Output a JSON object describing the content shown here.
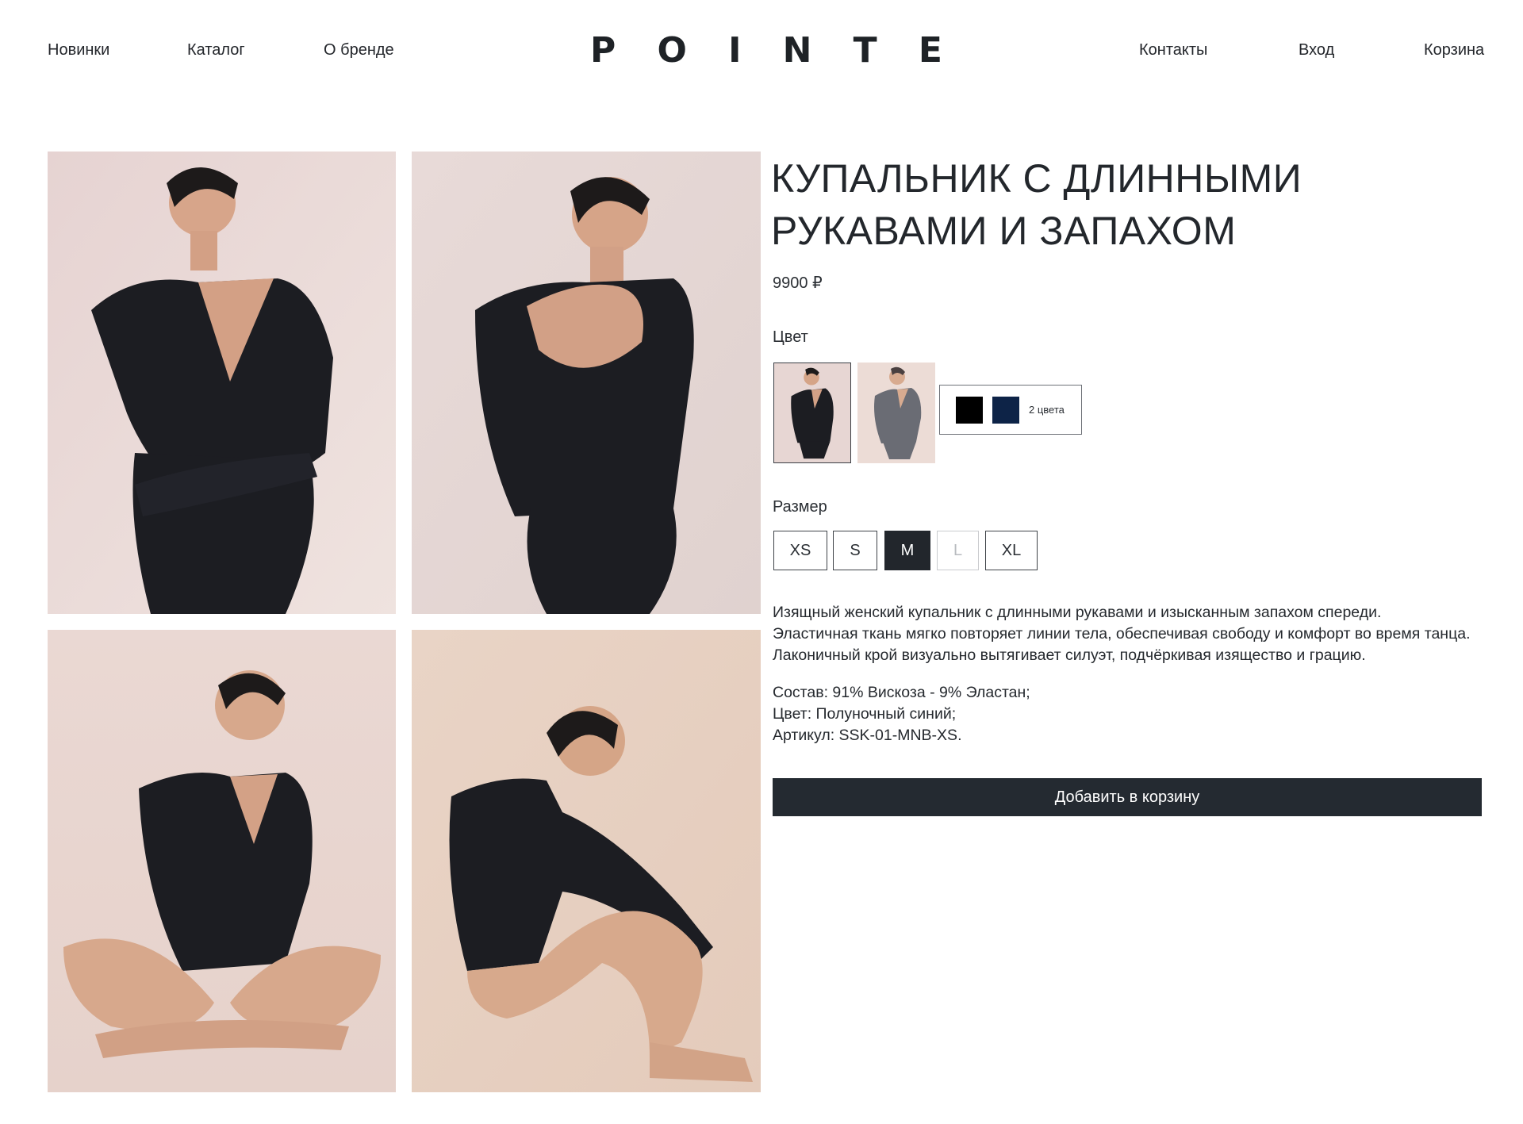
{
  "header": {
    "nav_left": [
      "Новинки",
      "Каталог",
      "О бренде"
    ],
    "logo_letters": [
      "P",
      "O",
      "I",
      "N",
      "T",
      "E"
    ],
    "nav_right": [
      "Контакты",
      "Вход",
      "Корзина"
    ]
  },
  "product": {
    "title_line1": "КУПАЛЬНИК С ДЛИННЫМИ",
    "title_line2": "РУКАВАМИ И ЗАПАХОМ",
    "price": "9900 ₽",
    "color_label": "Цвет",
    "colors": {
      "chips": [
        "#000000",
        "#0d2347"
      ],
      "count_label": "2 цвета"
    },
    "size_label": "Размер",
    "sizes": [
      {
        "label": "XS",
        "state": "default"
      },
      {
        "label": "S",
        "state": "default"
      },
      {
        "label": "M",
        "state": "selected"
      },
      {
        "label": "L",
        "state": "disabled"
      },
      {
        "label": "XL",
        "state": "default"
      }
    ],
    "description": "Изящный женский купальник с длинными рукавами и изысканным запахом спереди. Эластичная ткань мягко повторяет линии тела, обеспечивая свободу и комфорт во время танца. Лаконичный крой визуально вытягивает силуэт, подчёркивая изящество и грацию.",
    "specs": [
      "Состав: 91% Вискоза - 9% Эластан;",
      "Цвет: Полуночный синий;",
      "Артикул: SSK-01-MNB-XS."
    ],
    "add_to_cart": "Добавить в корзину"
  },
  "colors": {
    "accent_dark": "#242a31",
    "bodysuit": "#1c1d22",
    "backdrop_pink": "#ecdcd8",
    "backdrop_beige": "#e8d3c4",
    "skin": "#d9aa8f"
  }
}
